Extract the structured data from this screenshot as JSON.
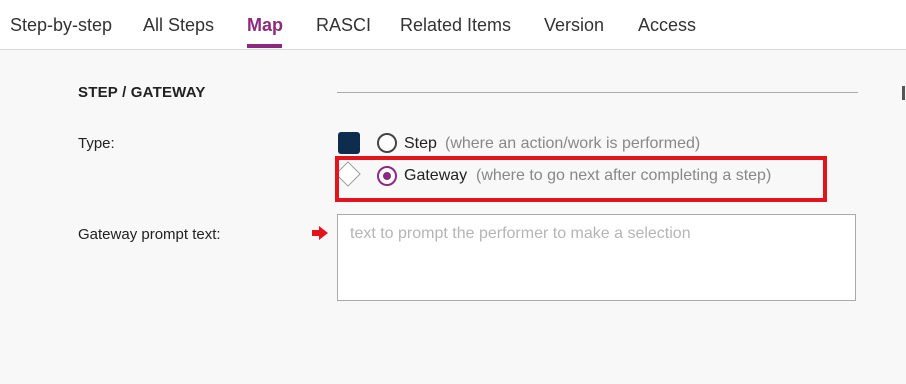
{
  "tabs": [
    {
      "label": "Step-by-step"
    },
    {
      "label": "All Steps"
    },
    {
      "label": "Map",
      "active": true
    },
    {
      "label": "RASCI"
    },
    {
      "label": "Related Items"
    },
    {
      "label": "Version"
    },
    {
      "label": "Access"
    }
  ],
  "section": {
    "title": "STEP / GATEWAY"
  },
  "type_field": {
    "label": "Type:",
    "options": [
      {
        "icon": "step-square-icon",
        "label": "Step",
        "hint": "(where an action/work is performed)",
        "selected": false
      },
      {
        "icon": "gateway-diamond-icon",
        "label": "Gateway",
        "hint": "(where to go next after completing a step)",
        "selected": true
      }
    ]
  },
  "prompt_field": {
    "label": "Gateway prompt text:",
    "value": "",
    "placeholder": "text to prompt the performer to make a selection",
    "indicator_icon": "arrow-right-icon"
  },
  "colors": {
    "accent": "#8c2a7f",
    "step_icon": "#0e2c4d",
    "highlight": "#e4141c"
  }
}
